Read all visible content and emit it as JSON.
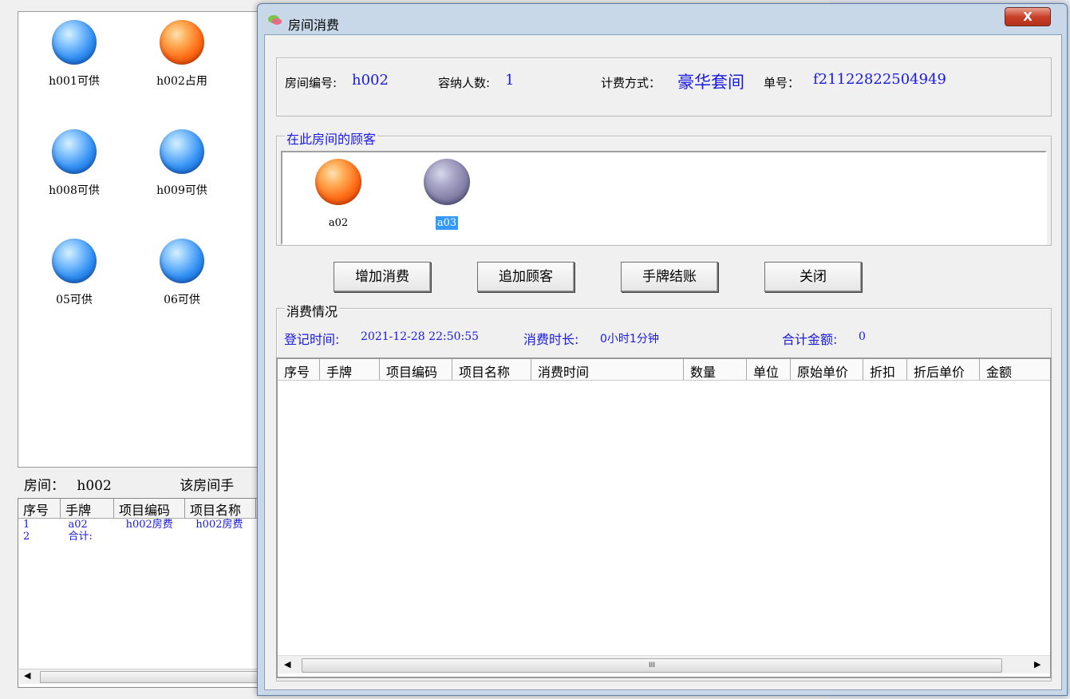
{
  "background_window": {
    "rooms": [
      {
        "label": "h001可供",
        "status": "available",
        "color": "#2f8ef2"
      },
      {
        "label": "h002占用",
        "status": "occupied",
        "color": "#ff6a14"
      },
      {
        "label": "h008可供",
        "status": "available",
        "color": "#2f8ef2"
      },
      {
        "label": "h009可供",
        "status": "available",
        "color": "#2f8ef2"
      },
      {
        "label": "05可供",
        "status": "available",
        "color": "#2f8ef2"
      },
      {
        "label": "06可供",
        "status": "available",
        "color": "#2f8ef2"
      }
    ],
    "room_info_label": "房间：",
    "room_info_value": "h002",
    "room_tag_text": "该房间手",
    "grid_headers": [
      "序号",
      "手牌",
      "项目编码",
      "项目名称"
    ],
    "grid_rows": [
      [
        "1",
        "a02",
        "h002房费",
        "h002房费"
      ],
      [
        "2",
        "合计:",
        "",
        ""
      ]
    ]
  },
  "dialog": {
    "title": "房间消费",
    "close_label": "X",
    "room_no_label": "房间编号:",
    "room_no_value": "h002",
    "capacity_label": "容纳人数:",
    "capacity_value": "1",
    "billing_label": "计费方式：",
    "billing_value": "豪华套间",
    "order_label": "单号：",
    "order_value": "f21122822504949",
    "guests_group_title": "在此房间的顾客",
    "guests": [
      {
        "label": "a02",
        "selected": false,
        "color": "#ff6a14"
      },
      {
        "label": "a03",
        "selected": true,
        "color": "#7e7aa2"
      }
    ],
    "buttons": {
      "add_consumption": "增加消费",
      "add_guest": "追加顾客",
      "checkout": "手牌结账",
      "close": "关闭"
    },
    "consumption_group_title": "消费情况",
    "checkin_label": "登记时间:",
    "checkin_value": "2021-12-28 22:50:55",
    "duration_label": "消费时长:",
    "duration_value": "0小时1分钟",
    "total_label": "合计金额:",
    "total_value": "0",
    "grid_headers": [
      "序号",
      "手牌",
      "项目编码",
      "项目名称",
      "消费时间",
      "数量",
      "单位",
      "原始单价",
      "折扣",
      "折后单价",
      "金额"
    ],
    "scroll_grip": "III"
  }
}
